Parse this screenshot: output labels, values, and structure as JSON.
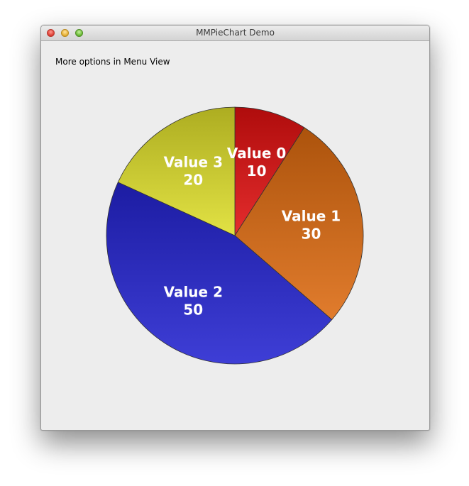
{
  "window": {
    "title": "MMPieChart Demo",
    "hint": "More options in Menu View"
  },
  "icons": {
    "close": "close-icon",
    "minimize": "minimize-icon",
    "zoom": "zoom-icon"
  },
  "chart_data": {
    "type": "pie",
    "categories": [
      "Value 0",
      "Value 1",
      "Value 2",
      "Value 3"
    ],
    "values": [
      10,
      30,
      50,
      20
    ],
    "colors": [
      "#e01010",
      "#dd6a10",
      "#2424d0",
      "#dede2a"
    ]
  }
}
